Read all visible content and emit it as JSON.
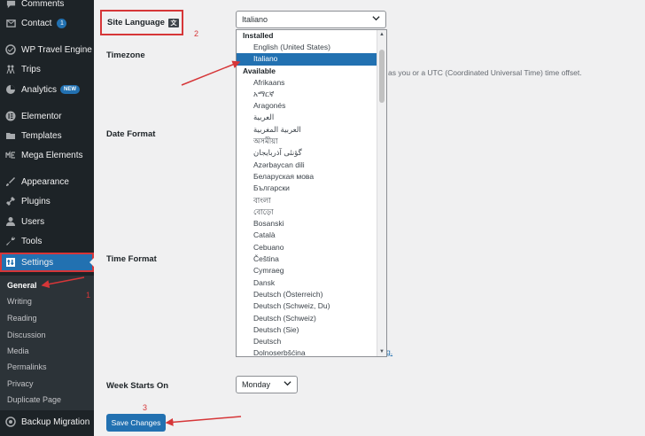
{
  "sidebar": {
    "items": [
      {
        "label": "Comments",
        "icon": "comments-icon"
      },
      {
        "label": "Contact",
        "icon": "contact-icon",
        "count": "1"
      },
      {
        "label": "WP Travel Engine",
        "icon": "wp-travel-engine-icon"
      },
      {
        "label": "Trips",
        "icon": "trips-icon"
      },
      {
        "label": "Analytics",
        "icon": "analytics-icon",
        "badge": "NEW"
      },
      {
        "label": "Elementor",
        "icon": "elementor-icon"
      },
      {
        "label": "Templates",
        "icon": "templates-icon"
      },
      {
        "label": "Mega Elements",
        "icon": "mega-elements-icon"
      },
      {
        "label": "Appearance",
        "icon": "appearance-icon"
      },
      {
        "label": "Plugins",
        "icon": "plugins-icon"
      },
      {
        "label": "Users",
        "icon": "users-icon"
      },
      {
        "label": "Tools",
        "icon": "tools-icon"
      },
      {
        "label": "Settings",
        "icon": "settings-icon"
      }
    ],
    "submenu": [
      "General",
      "Writing",
      "Reading",
      "Discussion",
      "Media",
      "Permalinks",
      "Privacy",
      "Duplicate Page"
    ],
    "backup": {
      "label": "Backup Migration",
      "icon": "backup-icon"
    }
  },
  "main": {
    "site_language_label": "Site Language",
    "timezone_label": "Timezone",
    "date_format_label": "Date Format",
    "time_format_label": "Time Format",
    "week_starts_label": "Week Starts On",
    "timezone_desc": "as you or a UTC (Coordinated Universal Time) time offset.",
    "link_fragment": "g.",
    "language_value": "Italiano",
    "week_value": "Monday",
    "save_label": "Save Changes"
  },
  "dropdown": {
    "installed_label": "Installed",
    "installed": [
      "English (United States)",
      "Italiano"
    ],
    "available_label": "Available",
    "available": [
      "Afrikaans",
      "አማርኛ",
      "Aragonés",
      "العربية",
      "العربية المغربية",
      "অসমীয়া",
      "گؤنئی آذربایجان",
      "Azərbaycan dili",
      "Беларуская мова",
      "Български",
      "বাংলা",
      "বোড়ো",
      "Bosanski",
      "Català",
      "Cebuano",
      "Čeština",
      "Cymraeg",
      "Dansk",
      "Deutsch (Österreich)",
      "Deutsch (Schweiz, Du)",
      "Deutsch (Schweiz)",
      "Deutsch (Sie)",
      "Deutsch",
      "Dolnoserbšćina"
    ]
  },
  "annotations": {
    "one": "1",
    "two": "2",
    "three": "3"
  },
  "colors": {
    "sidebar": "#1d2327",
    "accent": "#2271b1",
    "highlight": "#d63638"
  }
}
